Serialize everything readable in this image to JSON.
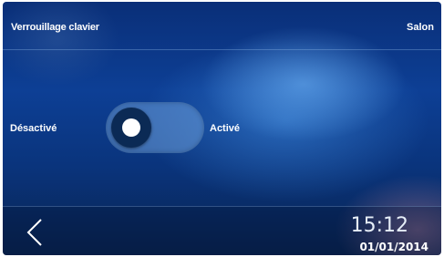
{
  "header": {
    "title": "Verrouillage clavier",
    "room": "Salon"
  },
  "toggle": {
    "label_off": "Désactivé",
    "label_on": "Activé",
    "state": "off"
  },
  "footer": {
    "time": "15:12",
    "date": "01/01/2014",
    "back_icon": "chevron-left-icon"
  },
  "colors": {
    "background": "#0d3f95",
    "toggle_track": "#6ea0dc",
    "knob": "#0b2a55"
  }
}
